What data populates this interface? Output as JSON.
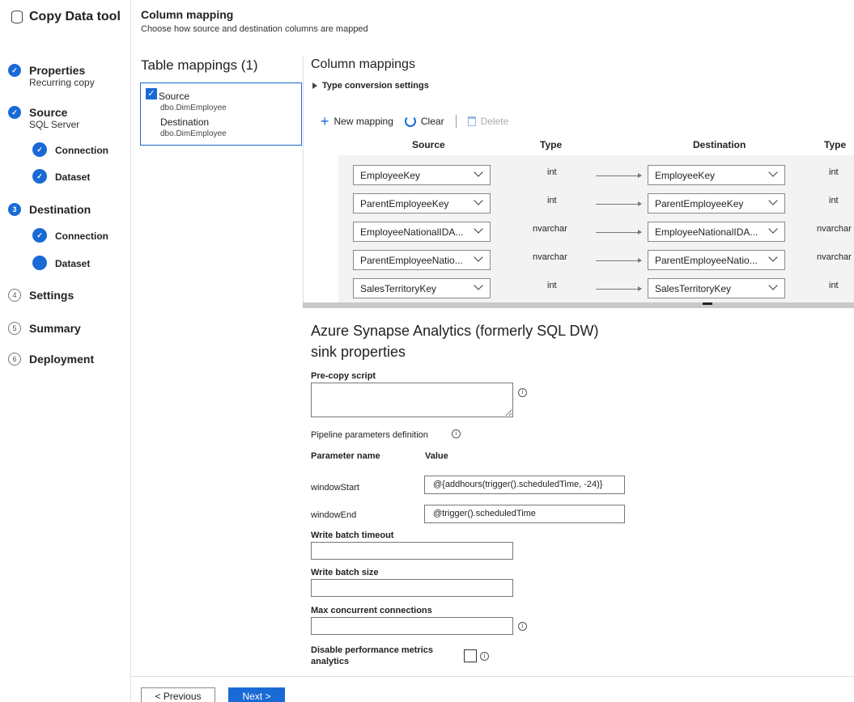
{
  "app": {
    "title": "Copy Data tool"
  },
  "steps": [
    {
      "label": "Properties",
      "sub": "Recurring copy",
      "marker": "✓",
      "state": "done"
    },
    {
      "label": "Source",
      "sub": "SQL Server",
      "marker": "✓",
      "state": "done"
    },
    {
      "label": "Connection",
      "marker": "✓",
      "state": "done",
      "substep": true
    },
    {
      "label": "Dataset",
      "marker": "✓",
      "state": "done",
      "substep": true
    },
    {
      "label": "Destination",
      "marker": "3",
      "state": "current"
    },
    {
      "label": "Connection",
      "marker": "✓",
      "state": "done",
      "substep": true
    },
    {
      "label": "Dataset",
      "marker": "",
      "state": "current",
      "substep": true
    },
    {
      "label": "Settings",
      "marker": "4",
      "state": "todo"
    },
    {
      "label": "Summary",
      "marker": "5",
      "state": "todo"
    },
    {
      "label": "Deployment",
      "marker": "6",
      "state": "todo"
    }
  ],
  "header": {
    "title": "Column mapping",
    "subtitle": "Choose how source and destination columns are mapped"
  },
  "table_mappings": {
    "title": "Table mappings (1)",
    "item": {
      "source_label": "Source",
      "source_value": "dbo.DimEmployee",
      "destination_label": "Destination",
      "destination_value": "dbo.DimEmployee",
      "checked": true
    }
  },
  "column_mappings": {
    "title": "Column mappings",
    "type_conversion": "Type conversion settings",
    "toolbar": {
      "new_mapping": "New mapping",
      "clear": "Clear",
      "delete": "Delete"
    },
    "headers": {
      "source": "Source",
      "type": "Type",
      "destination": "Destination",
      "dest_type": "Type"
    },
    "rows": [
      {
        "source": "EmployeeKey",
        "source_type": "int",
        "destination": "EmployeeKey",
        "dest_type": "int"
      },
      {
        "source": "ParentEmployeeKey",
        "source_type": "int",
        "destination": "ParentEmployeeKey",
        "dest_type": "int"
      },
      {
        "source": "EmployeeNationalIDA...",
        "source_type": "nvarchar",
        "destination": "EmployeeNationalIDA...",
        "dest_type": "nvarchar"
      },
      {
        "source": "ParentEmployeeNatio...",
        "source_type": "nvarchar",
        "destination": "ParentEmployeeNatio...",
        "dest_type": "nvarchar"
      },
      {
        "source": "SalesTerritoryKey",
        "source_type": "int",
        "destination": "SalesTerritoryKey",
        "dest_type": "int"
      }
    ]
  },
  "sink": {
    "title_line1": "Azure Synapse Analytics (formerly SQL DW)",
    "title_line2": "sink properties",
    "pre_copy_script": {
      "label": "Pre-copy script",
      "value": ""
    },
    "pipeline_params": {
      "label": "Pipeline parameters definition",
      "col_name": "Parameter name",
      "col_value": "Value",
      "params": [
        {
          "name": "windowStart",
          "value": "@{addhours(trigger().scheduledTime, -24)}"
        },
        {
          "name": "windowEnd",
          "value": "@trigger().scheduledTime"
        }
      ]
    },
    "write_batch_timeout": {
      "label": "Write batch timeout",
      "value": ""
    },
    "write_batch_size": {
      "label": "Write batch size",
      "value": ""
    },
    "max_concurrent": {
      "label": "Max concurrent connections",
      "value": ""
    },
    "disable_metrics": {
      "label_line1": "Disable performance metrics",
      "label_line2": "analytics",
      "checked": false
    }
  },
  "footer": {
    "previous": "< Previous",
    "next": "Next >"
  },
  "colors": {
    "accent": "#1a6ad6",
    "map_bg": "#f3f3f3"
  },
  "icons": {
    "app": "database-icon",
    "info": "info-icon",
    "add": "plus-icon",
    "clear": "refresh-icon",
    "delete": "trash-icon"
  }
}
